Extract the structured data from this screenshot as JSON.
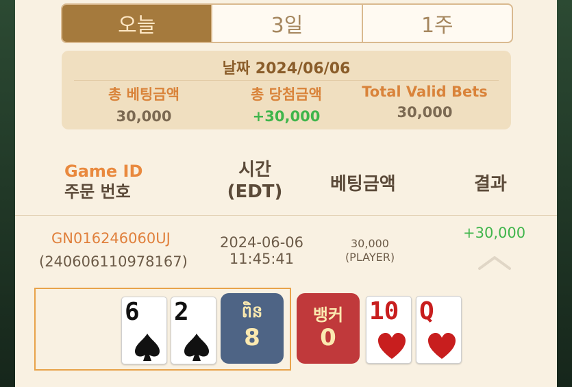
{
  "tabs": [
    {
      "label": "오늘",
      "active": true
    },
    {
      "label": "3일",
      "active": false
    },
    {
      "label": "1주",
      "active": false
    }
  ],
  "summary": {
    "date_label": "날짜 2024/06/06",
    "total_bet_label": "총 베팅금액",
    "total_bet_value": "30,000",
    "total_win_label": "총 당첨금액",
    "total_win_value": "+30,000",
    "valid_bets_label": "Total Valid Bets",
    "valid_bets_value": "30,000"
  },
  "table_headers": {
    "game_id": "Game ID",
    "order_no": "주문 번호",
    "time_line1": "시간",
    "time_line2": "(EDT)",
    "bet_amount": "베팅금액",
    "result": "결과"
  },
  "record": {
    "game_id": "GN016246060UJ",
    "order_no": "(240606110978167)",
    "date": "2024-06-06",
    "time": "11:45:41",
    "bet": "30,000",
    "bet_side": "(PLAYER)",
    "result": "+30,000"
  },
  "player_hand": {
    "cards": [
      {
        "rank": "6",
        "suit": "spade-icon",
        "color": "#111111"
      },
      {
        "rank": "2",
        "suit": "spade-icon",
        "color": "#111111"
      }
    ],
    "label": "ពិន",
    "score": "8",
    "color": "#4e6485"
  },
  "banker_hand": {
    "label": "뱅커",
    "score": "0",
    "color": "#c0393b",
    "cards": [
      {
        "rank": "10",
        "suit": "heart-icon",
        "color": "#c81e1e"
      },
      {
        "rank": "Q",
        "suit": "heart-icon",
        "color": "#c81e1e"
      }
    ]
  },
  "colors": {
    "accent_gold": "#a57a3d",
    "win_green": "#3fb54b",
    "orange": "#e0803c",
    "panel_bg": "#f9f1e2"
  }
}
